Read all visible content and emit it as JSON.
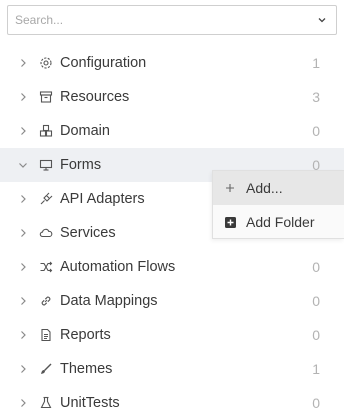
{
  "search": {
    "placeholder": "Search..."
  },
  "tree": [
    {
      "label": "Configuration",
      "count": "1",
      "icon": "gear-icon",
      "expanded": false
    },
    {
      "label": "Resources",
      "count": "3",
      "icon": "archive-icon",
      "expanded": false
    },
    {
      "label": "Domain",
      "count": "0",
      "icon": "cubes-icon",
      "expanded": false
    },
    {
      "label": "Forms",
      "count": "0",
      "icon": "monitor-icon",
      "expanded": true,
      "selected": true
    },
    {
      "label": "API Adapters",
      "count": "",
      "icon": "plug-icon",
      "expanded": false
    },
    {
      "label": "Services",
      "count": "",
      "icon": "cloud-icon",
      "expanded": false
    },
    {
      "label": "Automation Flows",
      "count": "0",
      "icon": "shuffle-icon",
      "expanded": false
    },
    {
      "label": "Data Mappings",
      "count": "0",
      "icon": "link-icon",
      "expanded": false
    },
    {
      "label": "Reports",
      "count": "0",
      "icon": "document-icon",
      "expanded": false
    },
    {
      "label": "Themes",
      "count": "1",
      "icon": "brush-icon",
      "expanded": false
    },
    {
      "label": "UnitTests",
      "count": "0",
      "icon": "flask-icon",
      "expanded": false
    }
  ],
  "context_menu": {
    "items": [
      {
        "label": "Add...",
        "icon": "plus-icon"
      },
      {
        "label": "Add Folder",
        "icon": "plus-square-icon"
      }
    ]
  }
}
